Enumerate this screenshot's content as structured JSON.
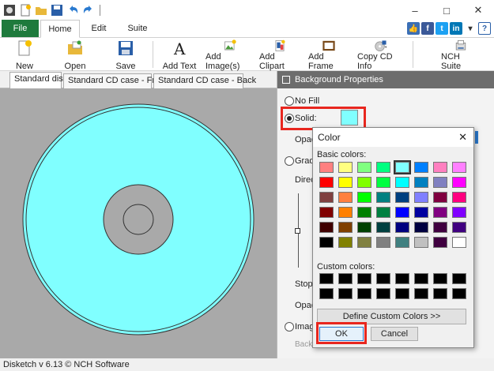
{
  "ribbon": {
    "tabs": [
      {
        "label": "File"
      },
      {
        "label": "Home"
      },
      {
        "label": "Edit"
      },
      {
        "label": "Suite"
      }
    ],
    "buttons": [
      {
        "label": "New",
        "icon": "new-document-icon"
      },
      {
        "label": "Open",
        "icon": "open-folder-icon"
      },
      {
        "label": "Save",
        "icon": "save-disk-icon"
      },
      {
        "label": "Add Text",
        "icon": "text-a-icon"
      },
      {
        "label": "Add Image(s)",
        "icon": "add-image-icon"
      },
      {
        "label": "Add Clipart",
        "icon": "clipart-icon"
      },
      {
        "label": "Add Frame",
        "icon": "frame-icon"
      },
      {
        "label": "Copy CD Info",
        "icon": "cd-info-icon"
      },
      {
        "label": "NCH Suite",
        "icon": "nch-suite-icon"
      }
    ]
  },
  "doc_tabs": [
    "Standard disc",
    "Standard CD case - Front",
    "Standard CD case - Back"
  ],
  "panel": {
    "title": "Background Properties",
    "no_fill": "No Fill",
    "solid": "Solid:",
    "opacity_label": "Opaci",
    "gradient_label": "Gradie",
    "direction_label": "Directi",
    "stop_label": "Stop F",
    "opacity2_label": "Opaci",
    "image_label": "Image",
    "bg_image_label": "Background Image Filename"
  },
  "dialog": {
    "title": "Color",
    "basic_colors_label": "Basic colors:",
    "custom_colors_label": "Custom colors:",
    "define_button": "Define Custom Colors >>",
    "ok_button": "OK",
    "cancel_button": "Cancel",
    "basic_colors": [
      "#ff8080",
      "#ffff80",
      "#80ff80",
      "#00ff80",
      "#80ffff",
      "#0080ff",
      "#ff80c0",
      "#ff80ff",
      "#ff0000",
      "#ffff00",
      "#80ff00",
      "#00ff40",
      "#00ffff",
      "#0080c0",
      "#8080c0",
      "#ff00ff",
      "#804040",
      "#ff8040",
      "#00ff00",
      "#008080",
      "#004080",
      "#8080ff",
      "#800040",
      "#ff0080",
      "#800000",
      "#ff8000",
      "#008000",
      "#008040",
      "#0000ff",
      "#0000a0",
      "#800080",
      "#8000ff",
      "#400000",
      "#804000",
      "#004000",
      "#004040",
      "#000080",
      "#000040",
      "#400040",
      "#400080",
      "#000000",
      "#808000",
      "#808040",
      "#808080",
      "#408080",
      "#c0c0c0",
      "#400040",
      "#ffffff"
    ],
    "custom_colors": [
      "#000000",
      "#000000",
      "#000000",
      "#000000",
      "#000000",
      "#000000",
      "#000000",
      "#000000",
      "#000000",
      "#000000",
      "#000000",
      "#000000",
      "#000000",
      "#000000",
      "#000000",
      "#000000"
    ]
  },
  "colors": {
    "disc_fill": "#80ffff",
    "canvas_bg": "#a9a9a9",
    "highlight": "#e8261e",
    "file_tab": "#1e7a3c"
  },
  "status": "Disketch v 6.13 © NCH Software"
}
